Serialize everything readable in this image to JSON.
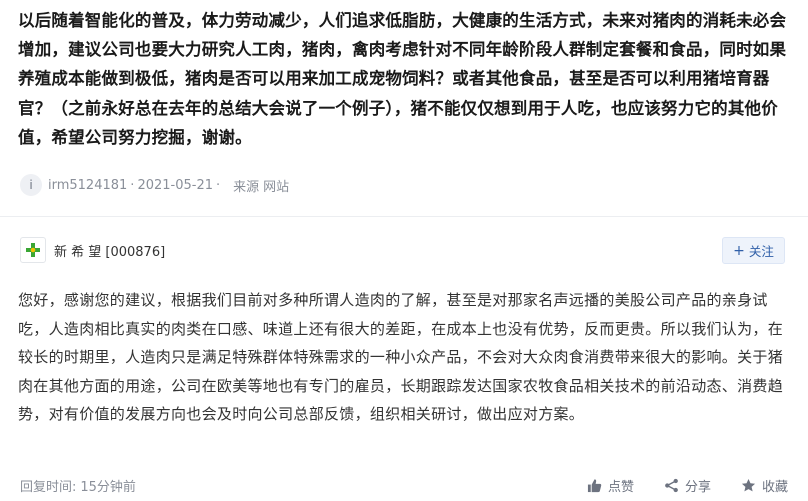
{
  "question": {
    "text": "以后随着智能化的普及，体力劳动减少，人们追求低脂肪，大健康的生活方式，未来对猪肉的消耗未必会增加，建议公司也要大力研究人工肉，猪肉，禽肉考虑针对不同年龄阶段人群制定套餐和食品，同时如果养殖成本能做到极低，猪肉是否可以用来加工成宠物饲料？或者其他食品，甚至是否可以利用猪培育器官？（之前永好总在去年的总结大会说了一个例子），猪不能仅仅想到用于人吃，也应该努力它的其他价值，希望公司努力挖掘，谢谢。",
    "avatar_letter": "i",
    "user": "irm5124181",
    "separator": "·",
    "date": "2021-05-21",
    "source_label": "来源",
    "source_value": "网站"
  },
  "company": {
    "name": "新 希 望 [000876]",
    "follow_label": "关注"
  },
  "answer": {
    "text": "您好，感谢您的建议，根据我们目前对多种所谓人造肉的了解，甚至是对那家名声远播的美股公司产品的亲身试吃，人造肉相比真实的肉类在口感、味道上还有很大的差距，在成本上也没有优势，反而更贵。所以我们认为，在较长的时期里，人造肉只是满足特殊群体特殊需求的一种小众产品，不会对大众肉食消费带来很大的影响。关于猪肉在其他方面的用途，公司在欧美等地也有专门的雇员，长期跟踪发达国家农牧食品相关技术的前沿动态、消费趋势，对有价值的发展方向也会及时向公司总部反馈，组织相关研讨，做出应对方案。",
    "reply_time_label": "回复时间:",
    "reply_time_value": "15分钟前"
  },
  "actions": {
    "like": "点赞",
    "share": "分享",
    "favorite": "收藏"
  },
  "colors": {
    "accent": "#2f5fa8",
    "logo_green": "#3aa635",
    "logo_yellow": "#f2c200"
  },
  "icons": [
    "thumbs-up-icon",
    "share-icon",
    "star-icon",
    "plus-icon",
    "company-logo-icon"
  ]
}
